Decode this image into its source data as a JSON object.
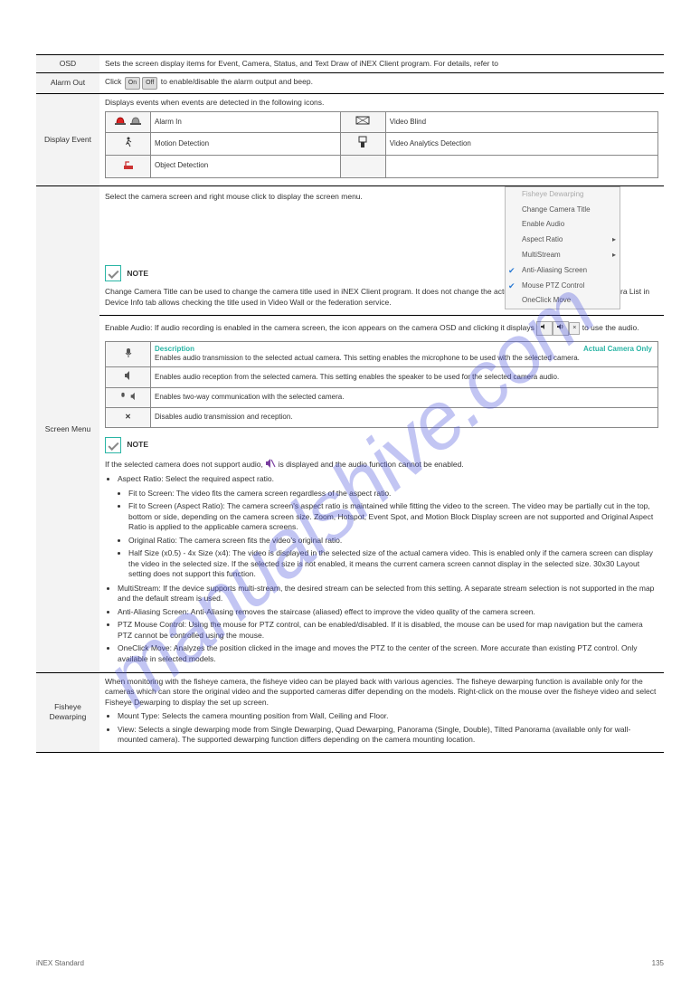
{
  "watermark": "manualshive.com",
  "rows": {
    "osd": {
      "label": "OSD",
      "text": "Sets the screen display items for Event, Camera, Status, and Text Draw of iNEX Client program. For details, refer to"
    },
    "alarmout": {
      "label": "Alarm Out",
      "text_a": "Click ",
      "on": "On",
      "off": "Off",
      "text_b": " to enable/disable the alarm output and beep."
    },
    "event": {
      "label": "Display Event",
      "intro": "Displays events when events are detected in the following icons.",
      "r1a": "Alarm In",
      "r1b": "Video Blind",
      "r2a": "Motion Detection",
      "r2b": "Video Analytics Detection",
      "r3a": "Object Detection"
    },
    "screenmenu": {
      "label": "Screen Menu",
      "intro": "Select the camera screen and right mouse click to display the screen menu.",
      "menu": {
        "fisheye": "Fisheye Dewarping",
        "changetitle": "Change Camera Title",
        "enableaudio": "Enable Audio",
        "aspect": "Aspect Ratio",
        "multistream": "MultiStream",
        "antialias": "Anti-Aliasing Screen",
        "mouseptz": "Mouse PTZ Control",
        "oneclick": "OneClick Move"
      },
      "note1_title": "NOTE",
      "note1_body": "Change Camera Title can be used to change the camera title used in iNEX Client program. It does not change the actual camera's title. Checking Camera List in Device Info tab allows checking the title used in Video Wall or the federation service.",
      "audio_intro": "Enable Audio: If audio recording is enabled in the camera screen, the icon appears on the camera OSD and clicking it displays ",
      "audio_ctrl": " to use the audio.",
      "audio_desc_header": "Description",
      "audio_r1_a": "Enables audio transmission to the selected actual camera. This setting enables the microphone to be used with the selected camera.",
      "audio_r1_b": "Actual Camera Only",
      "audio_r2": "Enables audio reception from the selected camera. This setting enables the speaker to be used for the selected camera audio.",
      "audio_r3": "Enables two-way communication with the selected camera.",
      "audio_r4": "Disables audio transmission and reception.",
      "note2_title": "NOTE",
      "note2_body_a": "If the selected camera does not support audio, ",
      "note2_body_b": " is displayed and the audio function cannot be enabled.",
      "bullets": {
        "aspect": "Aspect Ratio: Select the required aspect ratio.",
        "aspect_fit": "Fit to Screen: The video fits the camera screen regardless of the aspect ratio.",
        "aspect_fit_ar": "Fit to Screen (Aspect Ratio): The camera screen's aspect ratio is maintained while fitting the video to the screen. The video may be partially cut in the top, bottom or side, depending on the camera screen size. Zoom, Hotspot, Event Spot, and Motion Block Display screen are not supported and Original Aspect Ratio is applied to the applicable camera screens.",
        "orig": "Original Ratio: The camera screen fits the video's original ratio.",
        "half2": "Half Size (x0.5) - 4x Size (x4): The video is displayed in the selected size of the actual camera video. This is enabled only if the camera screen can display the video in the selected size. If the selected size is not enabled, it means the current camera screen cannot display in the selected size. 30x30 Layout setting does not support this function.",
        "multistream": "MultiStream: If the device supports multi-stream, the desired stream can be selected from this setting. A separate stream selection is not supported in the map and the default stream is used.",
        "antialias": "Anti-Aliasing Screen: Anti-Aliasing removes the staircase (aliased) effect to improve the video quality of the camera screen.",
        "mouseptz": "PTZ Mouse Control: Using the mouse for PTZ control, can be enabled/disabled. If it is disabled, the mouse can be used for map navigation but the camera PTZ cannot be controlled using the mouse.",
        "oneclick": "OneClick Move: Analyzes the position clicked in the image and moves the PTZ to the center of the screen. More accurate than existing PTZ control. Only available in selected models."
      }
    },
    "fisheye": {
      "label": "Fisheye Dewarping",
      "intro": "When monitoring with the fisheye camera, the fisheye video can be played back with various agencies. The fisheye dewarping function is available only for the cameras which can store the original video and the supported cameras differ depending on the models. Right-click on the mouse over the fisheye video and select Fisheye Dewarping to display the set up screen.",
      "b1": "Mount Type: Selects the camera mounting position from Wall, Ceiling and Floor.",
      "b2": "View: Selects a single dewarping mode from Single Dewarping, Quad Dewarping, Panorama (Single, Double), Tilted Panorama (available only for wall-mounted camera). The supported dewarping function differs depending on the camera mounting location."
    }
  },
  "footer": {
    "title": "iNEX Standard",
    "page": "135"
  }
}
